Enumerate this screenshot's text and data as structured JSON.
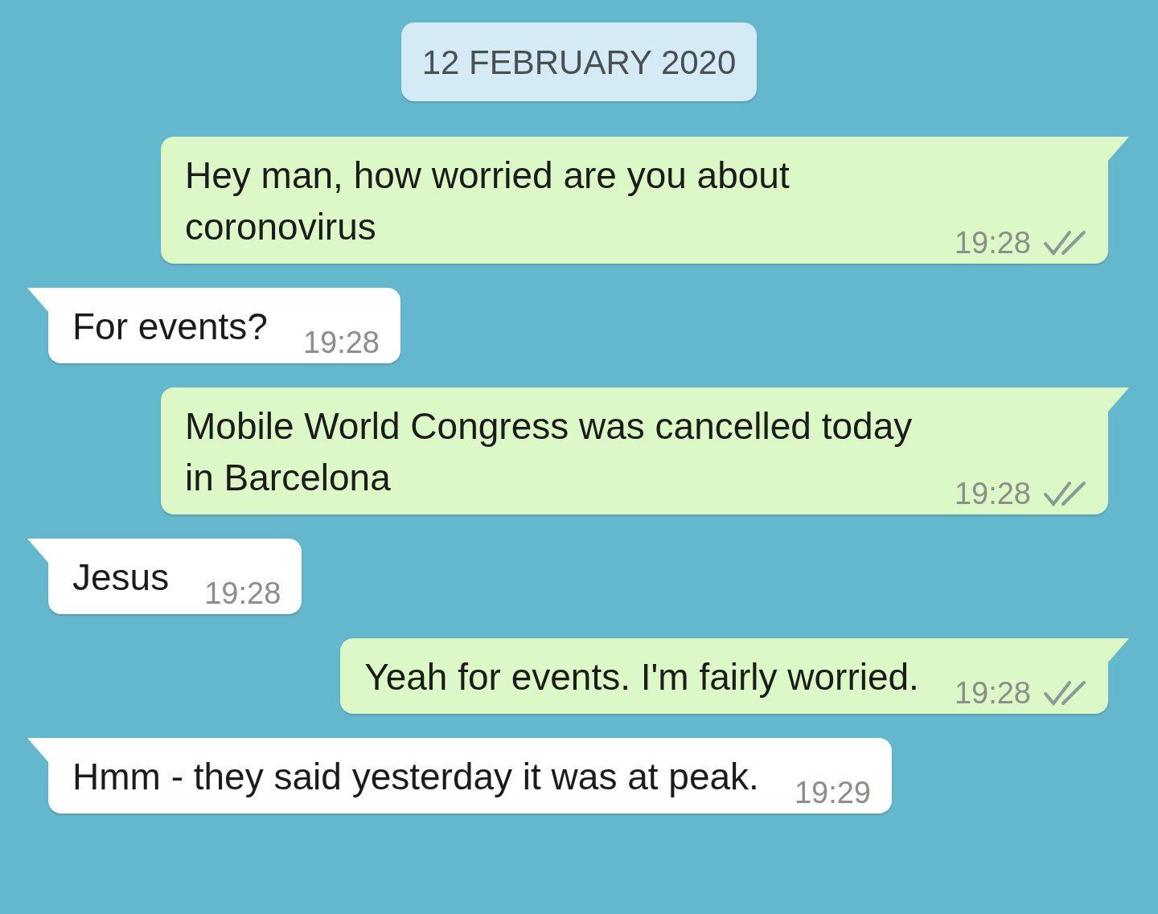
{
  "date_divider": "12 FEBRUARY 2020",
  "messages": [
    {
      "kind": "outgoing",
      "text": "Hey man, how worried are you about coronovirus",
      "time": "19:28",
      "ticks": true
    },
    {
      "kind": "incoming",
      "text": "For events?",
      "time": "19:28",
      "ticks": false
    },
    {
      "kind": "outgoing",
      "text": "Mobile World Congress was cancelled today in Barcelona",
      "time": "19:28",
      "ticks": true
    },
    {
      "kind": "incoming",
      "text": "Jesus",
      "time": "19:28",
      "ticks": false
    },
    {
      "kind": "outgoing",
      "text": "Yeah for events. I'm fairly worried.",
      "time": "19:28",
      "ticks": true
    },
    {
      "kind": "incoming",
      "text": "Hmm - they said yesterday it was at peak.",
      "time": "19:29",
      "ticks": false
    }
  ]
}
